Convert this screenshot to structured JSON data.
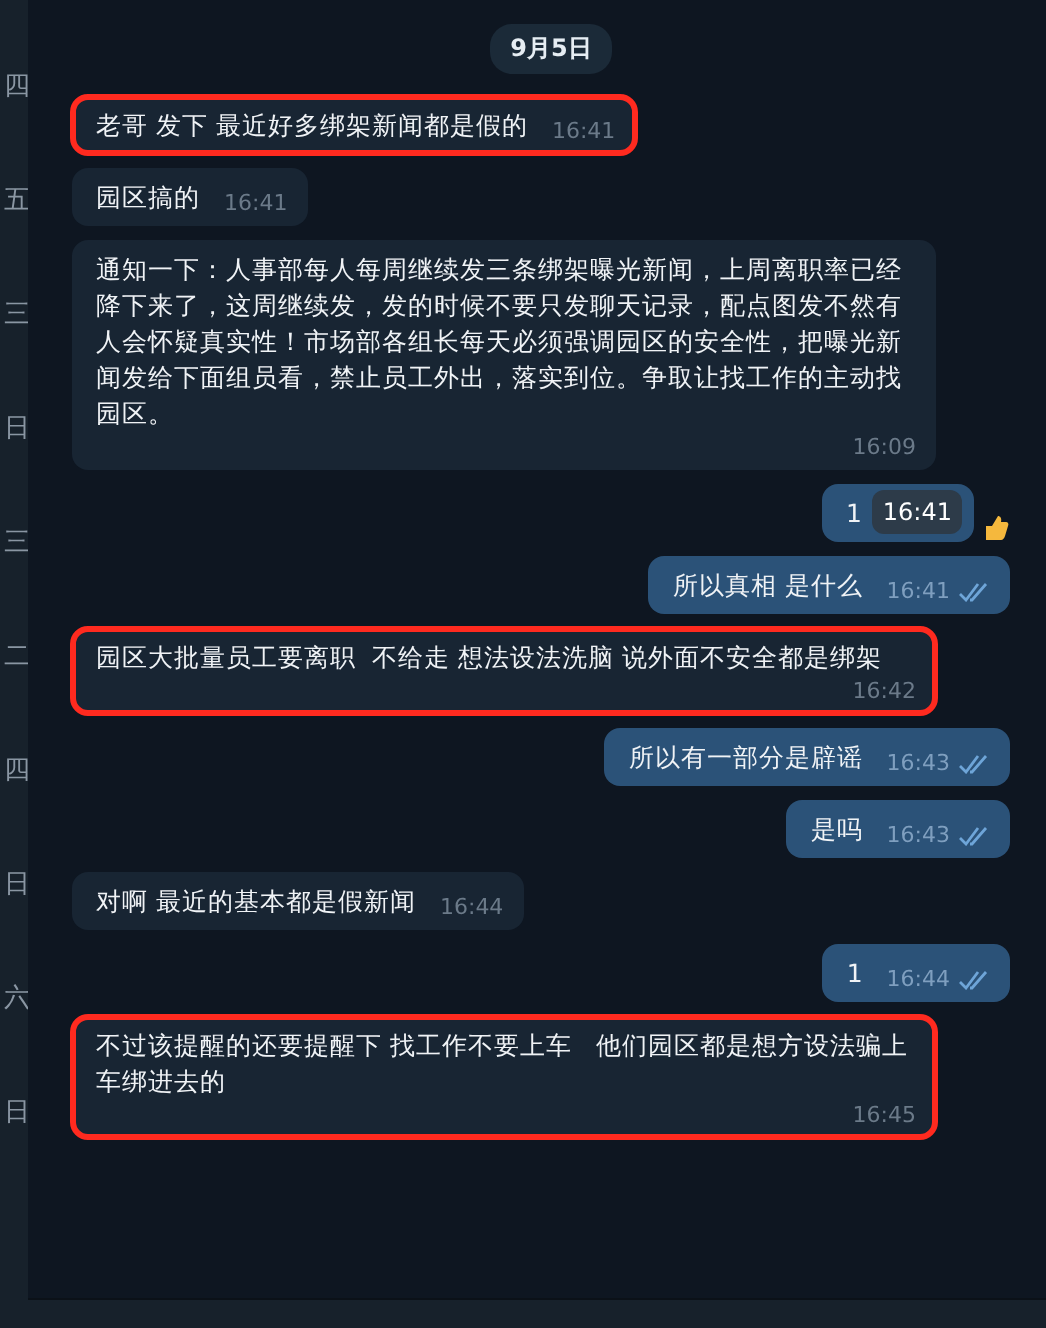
{
  "sidebar": {
    "weekdays": [
      "四",
      "五",
      "三",
      "日",
      "三",
      "二",
      "四",
      "日",
      "六",
      "日"
    ]
  },
  "date_badge": "9月5日",
  "messages": [
    {
      "kind": "incoming",
      "text": "老哥 发下 最近好多绑架新闻都是假的",
      "time": "16:41",
      "highlighted": true
    },
    {
      "kind": "incoming",
      "text": "园区搞的",
      "time": "16:41",
      "highlighted": false
    },
    {
      "kind": "incoming",
      "text": "通知一下：人事部每人每周继续发三条绑架曝光新闻，上周离职率已经降下来了，这周继续发，发的时候不要只发聊天记录，配点图发不然有人会怀疑真实性！市场部各组长每天必须强调园区的安全性，把曝光新闻发给下面组员看，禁止员工外出，落实到位。争取让找工作的主动找园区。",
      "time": "16:09",
      "highlighted": false
    },
    {
      "kind": "outgoing",
      "text": "1",
      "tooltip": "16:41",
      "reaction": true,
      "highlighted": false
    },
    {
      "kind": "outgoing",
      "text": "所以真相 是什么",
      "time": "16:41",
      "read": true,
      "highlighted": false
    },
    {
      "kind": "incoming",
      "text": "园区大批量员工要离职  不给走 想法设法洗脑 说外面不安全都是绑架",
      "time": "16:42",
      "highlighted": true
    },
    {
      "kind": "outgoing",
      "text": "所以有一部分是辟谣",
      "time": "16:43",
      "read": true,
      "highlighted": false
    },
    {
      "kind": "outgoing",
      "text": "是吗",
      "time": "16:43",
      "read": true,
      "highlighted": false
    },
    {
      "kind": "incoming",
      "text": "对啊 最近的基本都是假新闻",
      "time": "16:44",
      "highlighted": false
    },
    {
      "kind": "outgoing",
      "text": "1",
      "time": "16:44",
      "read": true,
      "highlighted": false
    },
    {
      "kind": "incoming",
      "text": "不过该提醒的还要提醒下 找工作不要上车   他们园区都是想方设法骗上车绑进去的",
      "time": "16:45",
      "highlighted": true
    }
  ]
}
